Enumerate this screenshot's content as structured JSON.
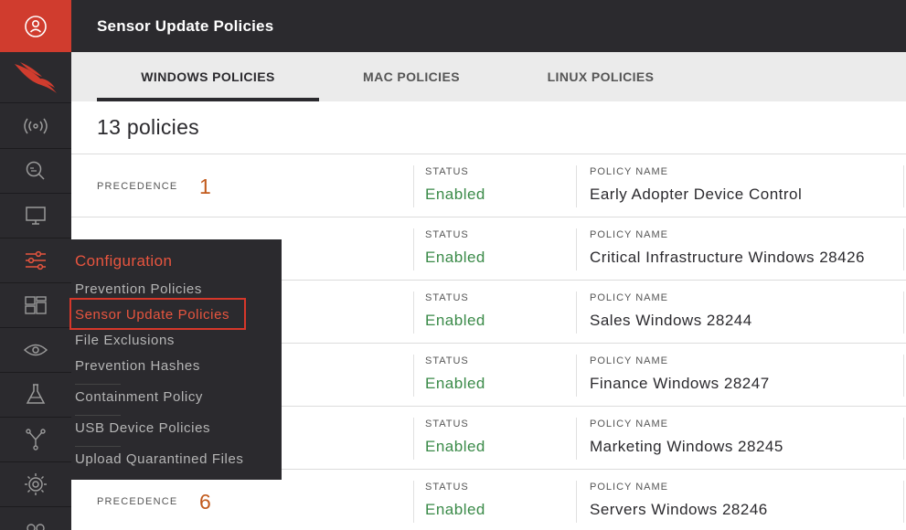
{
  "header": {
    "title": "Sensor Update Policies"
  },
  "tabs": [
    {
      "label": "WINDOWS POLICIES",
      "active": true
    },
    {
      "label": "MAC POLICIES",
      "active": false
    },
    {
      "label": "LINUX POLICIES",
      "active": false
    }
  ],
  "policy_count": "13 policies",
  "labels": {
    "precedence": "PRECEDENCE",
    "status": "STATUS",
    "policy_name": "POLICY NAME"
  },
  "rows": [
    {
      "precedence": "1",
      "status": "Enabled",
      "name": "Early Adopter Device Control"
    },
    {
      "precedence": "",
      "status": "Enabled",
      "name": "Critical Infrastructure Windows 28426"
    },
    {
      "precedence": "",
      "status": "Enabled",
      "name": "Sales Windows 28244"
    },
    {
      "precedence": "",
      "status": "Enabled",
      "name": "Finance Windows 28247"
    },
    {
      "precedence": "",
      "status": "Enabled",
      "name": "Marketing Windows 28245"
    },
    {
      "precedence": "6",
      "status": "Enabled",
      "name": "Servers Windows 28246"
    }
  ],
  "flyout": {
    "title": "Configuration",
    "items": [
      {
        "label": "Prevention Policies",
        "selected": false
      },
      {
        "label": "Sensor Update Policies",
        "selected": true
      },
      {
        "label": "File Exclusions",
        "selected": false
      },
      {
        "label": "Prevention Hashes",
        "selected": false
      },
      {
        "label": "Containment Policy",
        "selected": false
      },
      {
        "label": "USB Device Policies",
        "selected": false
      },
      {
        "label": "Upload Quarantined Files",
        "selected": false
      }
    ]
  },
  "sidebar": {
    "icons": [
      "user-icon",
      "falcon-logo-icon",
      "broadcast-icon",
      "search-activity-icon",
      "monitor-icon",
      "sliders-icon",
      "dashboard-icon",
      "eye-icon",
      "flask-icon",
      "network-icon",
      "gear-icon",
      "more-icon"
    ]
  },
  "colors": {
    "accent": "#d03c2e",
    "dark": "#2b2a2e",
    "status_enabled": "#3a8a48",
    "precedence": "#c25a1c",
    "flyout_highlight": "#e8553f"
  }
}
